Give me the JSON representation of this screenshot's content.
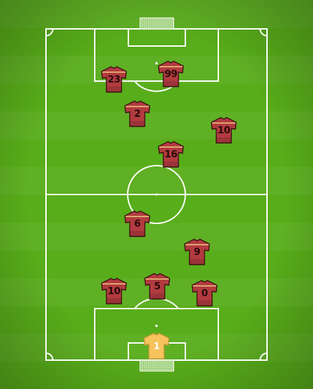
{
  "colors": {
    "grass_light": "#5fb71a",
    "grass_dark": "#3f9019",
    "line": "#ffffff",
    "outfield_kit": "#b23b40",
    "outfield_kit_trim": "#e8b97a",
    "outfield_number": "#2a0a0a",
    "goalkeeper_kit": "#f6c35d",
    "goalkeeper_number": "#ffffff"
  },
  "players": [
    {
      "number": "23",
      "role": "outfield"
    },
    {
      "number": "99",
      "role": "outfield"
    },
    {
      "number": "2",
      "role": "outfield"
    },
    {
      "number": "10",
      "role": "outfield"
    },
    {
      "number": "16",
      "role": "outfield"
    },
    {
      "number": "6",
      "role": "outfield"
    },
    {
      "number": "9",
      "role": "outfield"
    },
    {
      "number": "10",
      "role": "outfield"
    },
    {
      "number": "5",
      "role": "outfield"
    },
    {
      "number": "0",
      "role": "outfield"
    },
    {
      "number": "1",
      "role": "goalkeeper"
    }
  ]
}
